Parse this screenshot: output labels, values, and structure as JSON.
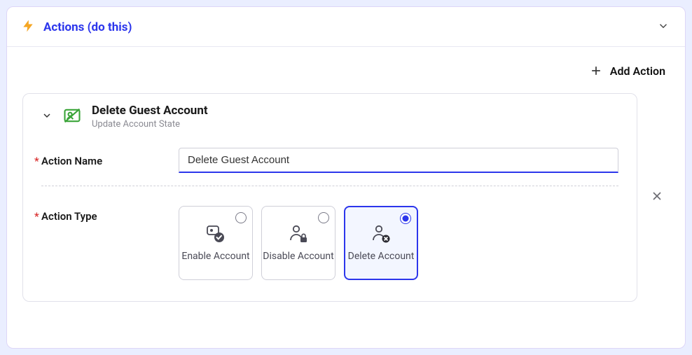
{
  "panel": {
    "title": "Actions (do this)"
  },
  "toolbar": {
    "add_label": "Add Action"
  },
  "action": {
    "title": "Delete Guest Account",
    "subtitle": "Update Account State",
    "name_label": "Action Name",
    "name_value": "Delete Guest Account",
    "type_label": "Action Type",
    "options": [
      {
        "label": "Enable Account",
        "selected": false
      },
      {
        "label": "Disable Account",
        "selected": false
      },
      {
        "label": "Delete Account",
        "selected": true
      }
    ]
  }
}
